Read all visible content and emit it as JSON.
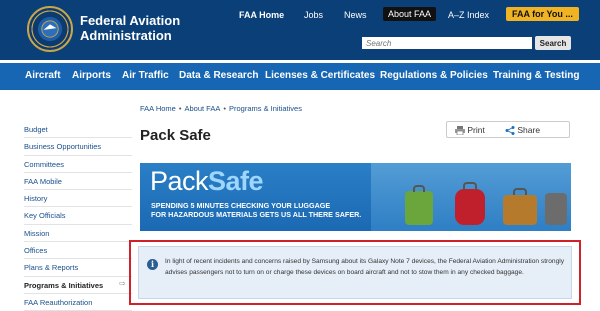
{
  "header": {
    "brand_line1": "Federal Aviation",
    "brand_line2": "Administration",
    "top_links": [
      "FAA Home",
      "Jobs",
      "News",
      "About FAA",
      "A–Z Index",
      "FAA for You ..."
    ],
    "search_placeholder": "Search",
    "search_button": "Search"
  },
  "main_nav": [
    "Aircraft",
    "Airports",
    "Air Traffic",
    "Data & Research",
    "Licenses & Certificates",
    "Regulations & Policies",
    "Training & Testing"
  ],
  "breadcrumb": [
    "FAA Home",
    "About FAA",
    "Programs & Initiatives"
  ],
  "page_title": "Pack Safe",
  "share": {
    "print": "Print",
    "share": "Share"
  },
  "sidebar": [
    "Budget",
    "Business Opportunities",
    "Committees",
    "FAA Mobile",
    "History",
    "Key Officials",
    "Mission",
    "Offices",
    "Plans & Reports",
    "Programs & Initiatives",
    "FAA Reauthorization"
  ],
  "sidebar_active_index": 9,
  "banner": {
    "title_a": "Pack",
    "title_b": "Safe",
    "tagline_line1": "SPENDING 5 MINUTES CHECKING YOUR LUGGAGE",
    "tagline_line2": "FOR HAZARDOUS MATERIALS GETS US ALL THERE SAFER."
  },
  "alert": {
    "icon": "info-icon",
    "text": "In light of recent incidents and concerns raised by Samsung about its Galaxy Note 7 devices, the Federal Aviation Administration strongly advises passengers not to turn on or charge these devices on board aircraft and not to stow them in any checked baggage."
  },
  "colors": {
    "header_bg": "#0a3f78",
    "nav_bg": "#1666b3",
    "accent_yellow": "#f0b323",
    "highlight_red": "#d0202a"
  }
}
